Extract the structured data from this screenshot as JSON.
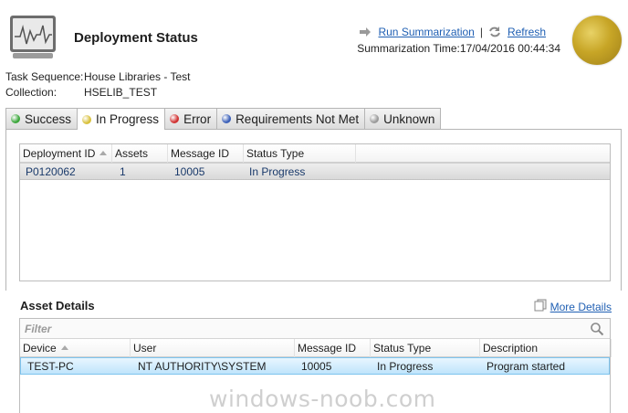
{
  "header": {
    "title": "Deployment Status",
    "run_summarization": "Run Summarization",
    "separator": "|",
    "refresh": "Refresh",
    "summarization_label": "Summarization Time:",
    "summarization_time": "17/04/2016 00:44:34",
    "status_color": "#c7a526"
  },
  "info": {
    "task_sequence_label": "Task Sequence:",
    "task_sequence_value": "House Libraries - Test",
    "collection_label": "Collection:",
    "collection_value": "HSELIB_TEST"
  },
  "tabs": [
    {
      "label": "Success",
      "color": "#3aa63a",
      "active": false
    },
    {
      "label": "In Progress",
      "color": "#d8c03a",
      "active": true
    },
    {
      "label": "Error",
      "color": "#d03030",
      "active": false
    },
    {
      "label": "Requirements Not Met",
      "color": "#3a5fb8",
      "active": false
    },
    {
      "label": "Unknown",
      "color": "#9a9a9a",
      "active": false
    }
  ],
  "deployments": {
    "columns": [
      "Deployment ID",
      "Assets",
      "Message ID",
      "Status Type"
    ],
    "rows": [
      {
        "deployment_id": "P0120062",
        "assets": "1",
        "message_id": "10005",
        "status_type": "In Progress"
      }
    ]
  },
  "asset_details": {
    "title": "Asset Details",
    "more_details": "More Details",
    "filter_placeholder": "Filter",
    "columns": [
      "Device",
      "User",
      "Message ID",
      "Status Type",
      "Description"
    ],
    "rows": [
      {
        "device": "TEST-PC",
        "user": "NT AUTHORITY\\SYSTEM",
        "message_id": "10005",
        "status_type": "In Progress",
        "description": "Program started"
      }
    ]
  },
  "watermark": "windows-noob.com"
}
